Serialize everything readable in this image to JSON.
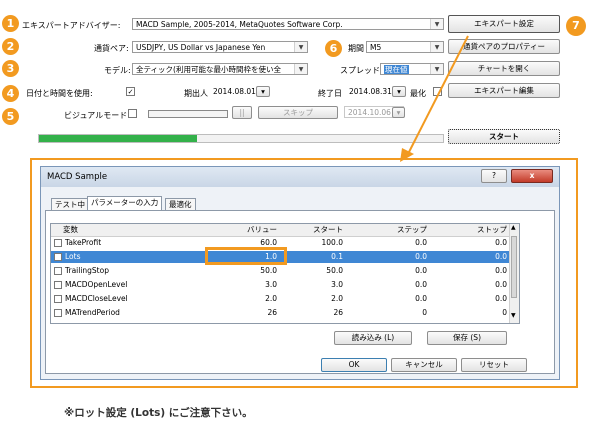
{
  "colors": {
    "accent": "#f29a20",
    "progress": "#33b14a",
    "selection": "#3f87d4"
  },
  "tester": {
    "expert_label": "エキスパートアドバイザー:",
    "expert_value": "MACD Sample, 2005-2014, MetaQuotes Software Corp.",
    "expert_settings_button": "エキスパート設定",
    "symbol_label": "通貨ペア:",
    "symbol_value": "USDJPY, US Dollar vs Japanese Yen",
    "period_label": "期間",
    "period_value": "M5",
    "symbol_props_button": "通貨ペアのプロパティー",
    "model_label": "モデル:",
    "model_value": "全ティック(利用可能な最小時間枠を使い全",
    "spread_label": "スプレッド",
    "spread_value": "現在値",
    "open_chart_button": "チャートを開く",
    "use_date_label": "日付と時間を使用:",
    "use_date_checked": "✓",
    "from_label": "期出人",
    "from_value": "2014.08.01",
    "to_label": "終了日",
    "to_value": "2014.08.31",
    "optimize_label": "最化",
    "edit_expert_button": "エキスパート編集",
    "visual_label": "ビジュアルモード",
    "pause_glyph": "||",
    "skip_button": "スキップ",
    "skip_date": "2014.10.06",
    "start_button": "スタート",
    "progress_fraction": 0.39
  },
  "badges": [
    "1",
    "2",
    "3",
    "4",
    "5",
    "6",
    "7"
  ],
  "dialog": {
    "title": "MACD Sample",
    "help_glyph": "?",
    "close_glyph": "x",
    "tabs": [
      "テスト中",
      "パラメーターの入力",
      "最適化"
    ],
    "columns": [
      "変数",
      "バリュー",
      "スタート",
      "ステップ",
      "ストップ"
    ],
    "rows": [
      {
        "name": "TakeProfit",
        "value": "60.0",
        "start": "100.0",
        "step": "0.0",
        "stop": "0.0"
      },
      {
        "name": "Lots",
        "value": "1.0",
        "start": "0.1",
        "step": "0.0",
        "stop": "0.0"
      },
      {
        "name": "TrailingStop",
        "value": "50.0",
        "start": "50.0",
        "step": "0.0",
        "stop": "0.0"
      },
      {
        "name": "MACDOpenLevel",
        "value": "3.0",
        "start": "3.0",
        "step": "0.0",
        "stop": "0.0"
      },
      {
        "name": "MACDCloseLevel",
        "value": "2.0",
        "start": "2.0",
        "step": "0.0",
        "stop": "0.0"
      },
      {
        "name": "MATrendPeriod",
        "value": "26",
        "start": "26",
        "step": "0",
        "stop": "0"
      }
    ],
    "load_button": "読み込み (L)",
    "save_button": "保存 (S)",
    "ok_button": "OK",
    "cancel_button": "キャンセル",
    "reset_button": "リセット"
  },
  "note": "※ロット設定 (Lots) にご注意下さい。"
}
